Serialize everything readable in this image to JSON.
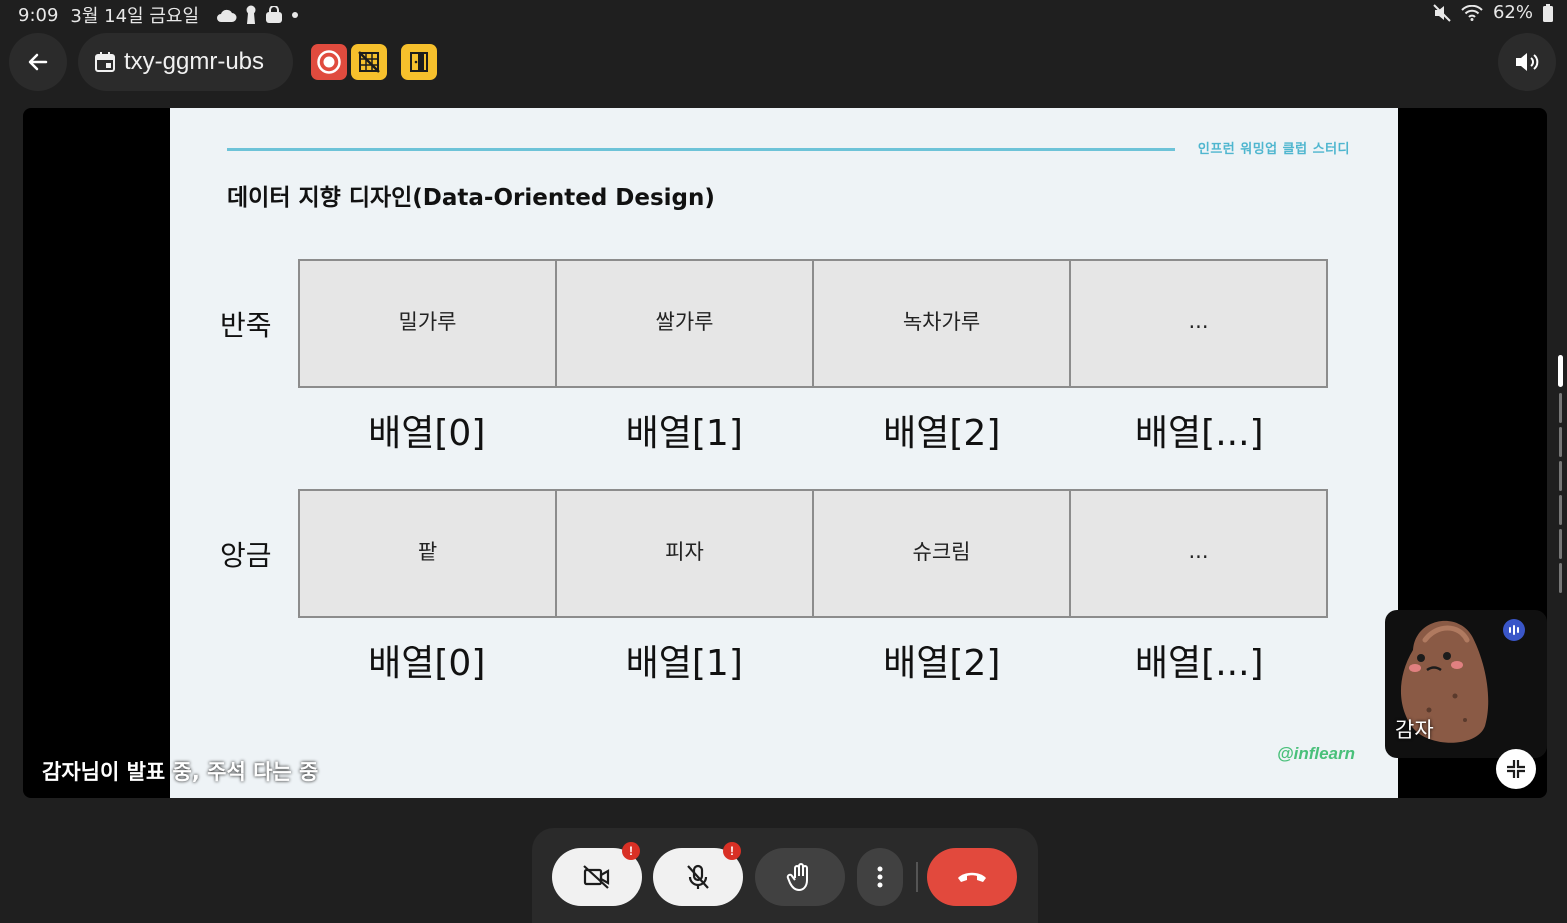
{
  "status_bar": {
    "time": "9:09",
    "date": "3월 14일 금요일",
    "battery": "62%",
    "left_icons": [
      "cloud-icon",
      "keyhole-icon",
      "bag-icon",
      "dot-icon"
    ],
    "right_icons": [
      "mute-icon",
      "wifi-icon",
      "battery-icon"
    ]
  },
  "top_bar": {
    "meeting_code": "txy-ggmr-ubs",
    "badges": [
      "record-icon",
      "no-wifi-grid-icon",
      "door-icon"
    ]
  },
  "slide": {
    "tag": "인프런 워밍업 클럽 스터디",
    "title": "데이터 지향 디자인(Data-Oriented Design)",
    "logo": "@inflearn",
    "rows": [
      {
        "label": "반죽",
        "cells": [
          "밀가루",
          "쌀가루",
          "녹차가루",
          "..."
        ],
        "indices": [
          "배열[0]",
          "배열[1]",
          "배열[2]",
          "배열[...]"
        ]
      },
      {
        "label": "앙금",
        "cells": [
          "팥",
          "피자",
          "슈크림",
          "..."
        ],
        "indices": [
          "배열[0]",
          "배열[1]",
          "배열[2]",
          "배열[...]"
        ]
      }
    ]
  },
  "presenter_status": "감자님이 발표 중, 주석 다는 중",
  "self_tile": {
    "name": "감자"
  },
  "controls": {
    "camera_alert": "!",
    "mic_alert": "!"
  },
  "colors": {
    "accent_line": "#6dc3d8",
    "end_call": "#e2493d",
    "record_badge": "#e04b3e",
    "yellow_badge": "#f6c02c",
    "logo_green": "#49c07a"
  }
}
